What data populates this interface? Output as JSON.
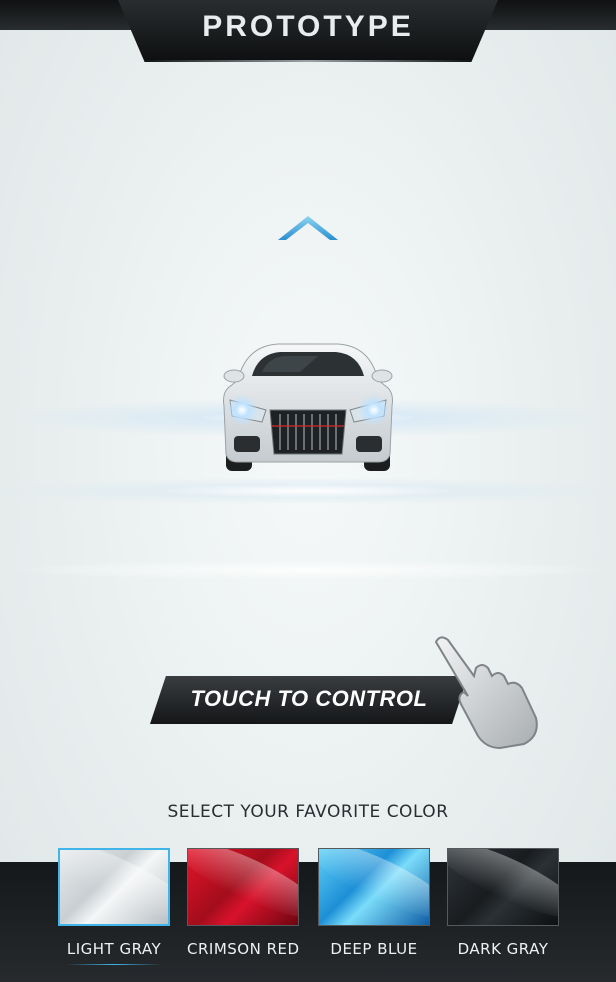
{
  "header": {
    "title": "PROTOTYPE"
  },
  "main": {
    "touch_label": "TOUCH TO CONTROL",
    "select_label": "SELECT YOUR FAVORITE COLOR"
  },
  "colors": {
    "selected": "LIGHT GRAY",
    "items": [
      {
        "label": "LIGHT GRAY",
        "hex": "#d6dbde"
      },
      {
        "label": "CRIMSON RED",
        "hex": "#c4101f"
      },
      {
        "label": "DEEP BLUE",
        "hex": "#2aa6e6"
      },
      {
        "label": "DARK GRAY",
        "hex": "#1e2225"
      }
    ]
  },
  "accent": "#41b5ea"
}
